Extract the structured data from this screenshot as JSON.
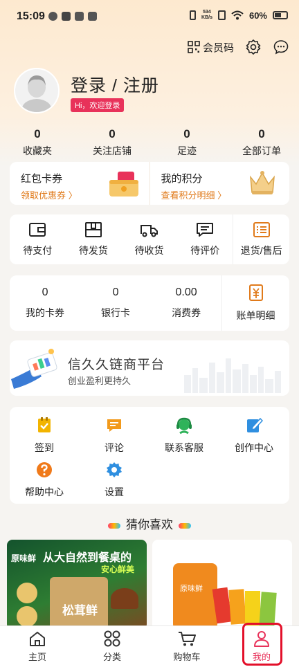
{
  "status_bar": {
    "time": "15:09",
    "speed_value": "534",
    "speed_unit": "KB/s",
    "battery": "60%"
  },
  "header": {
    "member_code": "会员码"
  },
  "profile": {
    "title": "登录 / 注册",
    "badge": "Hi，欢迎登录"
  },
  "stats": [
    {
      "value": "0",
      "label": "收藏夹"
    },
    {
      "value": "0",
      "label": "关注店铺"
    },
    {
      "value": "0",
      "label": "足迹"
    },
    {
      "value": "0",
      "label": "全部订单"
    }
  ],
  "coupons": {
    "title": "红包卡券",
    "link": "领取优惠券 〉"
  },
  "points": {
    "title": "我的积分",
    "link": "查看积分明细 〉"
  },
  "orders": [
    {
      "label": "待支付",
      "icon": "wallet-icon"
    },
    {
      "label": "待发货",
      "icon": "package-icon"
    },
    {
      "label": "待收货",
      "icon": "truck-icon"
    },
    {
      "label": "待评价",
      "icon": "comment-icon"
    },
    {
      "label": "退货/售后",
      "icon": "return-icon"
    }
  ],
  "wallet": [
    {
      "value": "0",
      "label": "我的卡券"
    },
    {
      "value": "0",
      "label": "银行卡"
    },
    {
      "value": "0.00",
      "label": "消费券"
    }
  ],
  "bill": {
    "label": "账单明细"
  },
  "banner": {
    "title": "信久久链商平台",
    "subtitle": "创业盈利更持久"
  },
  "services": [
    {
      "label": "签到",
      "icon": "checkin-icon",
      "color": "#f2b400"
    },
    {
      "label": "评论",
      "icon": "review-icon",
      "color": "#f29a1c"
    },
    {
      "label": "联系客服",
      "icon": "customer-service-icon",
      "color": "#2fb35a"
    },
    {
      "label": "创作中心",
      "icon": "edit-icon",
      "color": "#2f8fe0"
    },
    {
      "label": "帮助中心",
      "icon": "help-icon",
      "color": "#f07a1a"
    },
    {
      "label": "设置",
      "icon": "settings-icon",
      "color": "#2f8fe0"
    }
  ],
  "recommend": {
    "title": "猜你喜欢"
  },
  "products": {
    "p1_headline_a": "从大自然到餐桌的",
    "p1_headline_b": "安心鲜美",
    "p1_brand": "原味鲜",
    "p1_name": "松茸鲜",
    "p2_name": "原味鲜"
  },
  "nav": [
    {
      "label": "主页",
      "icon": "home-icon"
    },
    {
      "label": "分类",
      "icon": "category-icon"
    },
    {
      "label": "购物车",
      "icon": "cart-icon"
    },
    {
      "label": "我的",
      "icon": "user-icon"
    }
  ],
  "colors": {
    "accent": "#e8325a",
    "link_orange": "#e07a1a",
    "highlight_frame": "#e3102a"
  }
}
